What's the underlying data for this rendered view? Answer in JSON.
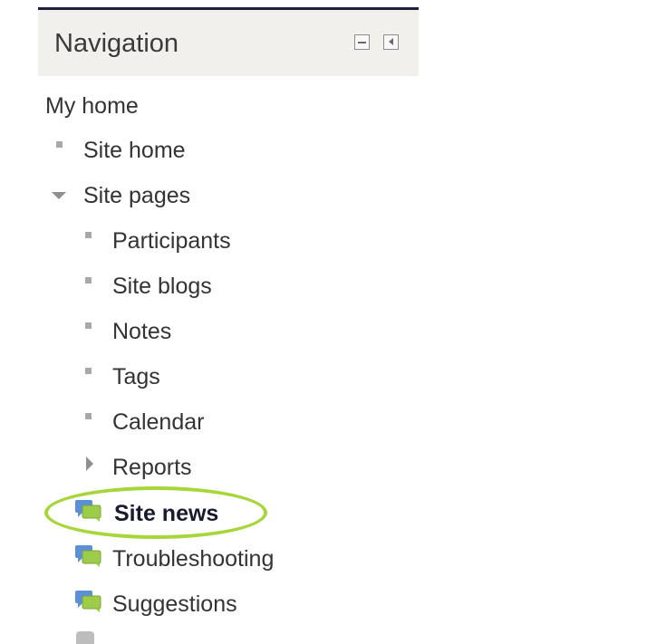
{
  "block": {
    "title": "Navigation",
    "controls": [
      "minus-icon",
      "dock-left-icon"
    ]
  },
  "nav": {
    "root": "My home",
    "site_home": "Site home",
    "site_pages": "Site pages",
    "pages": [
      "Participants",
      "Site blogs",
      "Notes",
      "Tags",
      "Calendar",
      "Reports"
    ],
    "forums": [
      "Site news",
      "Troubleshooting",
      "Suggestions"
    ],
    "highlighted": "Site news"
  },
  "colors": {
    "highlight_ring": "#a6d63a",
    "header_bg": "#f2f0ec",
    "header_border": "#1f1f3d"
  }
}
